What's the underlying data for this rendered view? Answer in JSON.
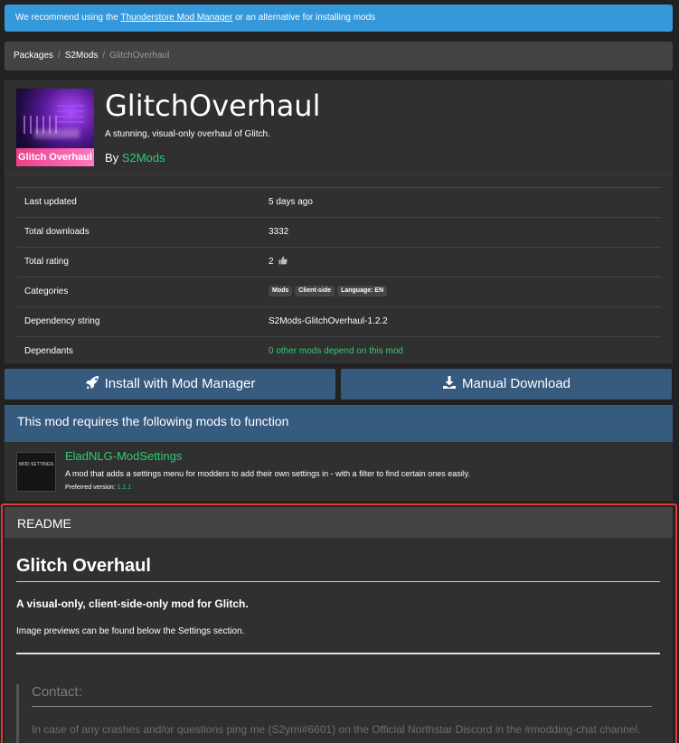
{
  "banner": {
    "prefix": "We recommend using the ",
    "link": "Thunderstore Mod Manager",
    "suffix": " or an alternative for installing mods"
  },
  "breadcrumb": {
    "items": [
      "Packages",
      "S2Mods",
      "GlitchOverhaul"
    ],
    "separator": "/"
  },
  "package": {
    "thumbnail_label": "Glitch Overhaul",
    "title": "GlitchOverhaul",
    "description": "A stunning, visual-only overhaul of Glitch.",
    "by_label": "By ",
    "author": "S2Mods"
  },
  "info": {
    "last_updated_label": "Last updated",
    "last_updated": "5 days ago",
    "downloads_label": "Total downloads",
    "downloads": "3332",
    "rating_label": "Total rating",
    "rating": "2",
    "categories_label": "Categories",
    "categories": [
      "Mods",
      "Client-side",
      "Language: EN"
    ],
    "dependency_label": "Dependency string",
    "dependency": "S2Mods-GlitchOverhaul-1.2.2",
    "dependants_label": "Dependants",
    "dependants": "0 other mods depend on this mod"
  },
  "actions": {
    "install": "Install with Mod Manager",
    "download": "Manual Download"
  },
  "requirements": {
    "heading": "This mod requires the following mods to function",
    "dependency": {
      "thumb_label": "MOD SETTINGS",
      "name": "EladNLG-ModSettings",
      "description": "A mod that adds a settings menu for modders to add their own settings in - with a filter to find certain ones easily.",
      "version_label": "Preferred version: ",
      "version": "1.1.1"
    }
  },
  "readme": {
    "heading": "README",
    "h1": "Glitch Overhaul",
    "lead": "A visual-only, client-side-only mod for Glitch.",
    "note": "Image previews can be found below the Settings section.",
    "contact_heading": "Contact:",
    "contact_text": "In case of any crashes and/or questions ping me (S2ymi#6601) on the Official Northstar Discord in the #modding-chat channel."
  },
  "colors": {
    "banner": "#3498db",
    "panel": "#303030",
    "primary": "#375a7f",
    "link_green": "#2ecc71",
    "highlight_border": "#e53935"
  }
}
